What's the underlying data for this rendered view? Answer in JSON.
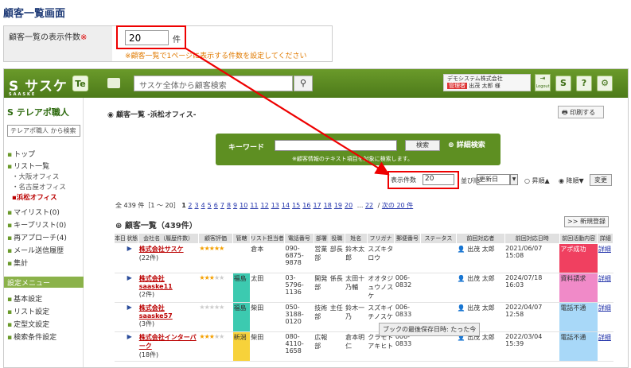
{
  "page": {
    "title": "顧客一覧画面"
  },
  "setting": {
    "label": "顧客一覧の表示件数",
    "required_mark": "※",
    "value": "20",
    "unit": "件",
    "note": "※顧客一覧で1ページに表示する件数を設定してください"
  },
  "topbar": {
    "logo": "サスケ",
    "logo_sub": "SAASKE",
    "te_label": "Te",
    "search_placeholder": "サスケ全体から顧客検索",
    "company": "デモシステム株式会社",
    "user_tag": "管理者",
    "user_name": "出茂 太郎 様",
    "logout_label": "Logout",
    "s_btn": "S",
    "help_btn": "?"
  },
  "sidebar": {
    "title": "テレアポ職人",
    "search_placeholder": "テレアポ職人 から検索",
    "items": [
      "トップ",
      "リスト一覧",
      "大阪オフィス",
      "名古屋オフィス",
      "浜松オフィス",
      "マイリスト(0)",
      "キープリスト(0)",
      "再アプローチ(4)",
      "メール送信履歴",
      "集計"
    ],
    "settings_title": "設定メニュー",
    "settings_items": [
      "基本設定",
      "リスト設定",
      "定型文設定",
      "検索条件設定"
    ]
  },
  "main": {
    "breadcrumb": "顧客一覧 -浜松オフィス-",
    "print_label": "印刷する",
    "keyword_label": "キーワード",
    "search_button": "検索",
    "detail_search": "詳細検索",
    "keyword_note": "※顧客情報のテキスト項目を対象に検索します。",
    "count_label": "表示件数",
    "count_value": "20",
    "sort_label": "並び順",
    "sort_value": "更新日",
    "asc_label": "昇順▲",
    "desc_label": "降順▼",
    "change_button": "変更",
    "pager_prefix": "全 439 件［1 ～ 20］",
    "pager_current": "1",
    "pager_links": [
      "2",
      "3",
      "4",
      "5",
      "6",
      "7",
      "8",
      "9",
      "10",
      "11",
      "12",
      "13",
      "14",
      "15",
      "16",
      "17",
      "18",
      "19",
      "20"
    ],
    "pager_dots": "...",
    "pager_last": "22",
    "pager_next": "次の 20 件",
    "list_title": "顧客一覧（439件）",
    "new_button": ">> 新規登録",
    "tooltip": "ブックの最後保存日時: たった今"
  },
  "table": {
    "headers": [
      "本日",
      "状態",
      "会社名（履歴件数）",
      "顧客評価",
      "管轄",
      "リスト担当者",
      "電話番号",
      "部署",
      "役職",
      "姓名",
      "フリガナ",
      "郵便番号",
      "ステータス",
      "前回対応者",
      "前回対応日時",
      "前回活動内容",
      "詳細"
    ],
    "rows": [
      {
        "name": "株式会社サスケ",
        "count": "(22件)",
        "stars": 5,
        "pref": "",
        "rep": "倉本",
        "tel": "090-6875-9878",
        "dept": "営業部",
        "pos": "部長",
        "person": "鈴木太郎",
        "kana": "スズキタロウ",
        "zip": "",
        "resp": "出茂 太郎",
        "date": "2021/06/07 15:08",
        "activity": "アポ成功",
        "cls": "status-red",
        "detail": "詳細"
      },
      {
        "name": "株式会社saaske11",
        "count": "(2件)",
        "stars": 3,
        "pref": "福島",
        "rep": "太田",
        "tel": "03-5796-1136",
        "dept": "開発部",
        "pos": "係長",
        "person": "太田十乃輔",
        "kana": "オオタジュウノスケ",
        "zip": "006-0832",
        "resp": "出茂 太郎",
        "date": "2024/07/18 16:03",
        "activity": "資料請求",
        "cls": "status-pink",
        "detail": "詳細"
      },
      {
        "name": "株式会社saaske57",
        "count": "(3件)",
        "stars": 0,
        "pref": "福島",
        "rep": "柴田",
        "tel": "050-3188-0120",
        "dept": "技術部",
        "pos": "主任",
        "person": "鈴木一乃",
        "kana": "スズキイチノスケ",
        "zip": "006-0833",
        "resp": "出茂 太郎",
        "date": "2022/04/07 12:58",
        "activity": "電話不通",
        "cls": "status-blue",
        "detail": "詳細"
      },
      {
        "name": "株式会社インターパーク",
        "count": "(18件)",
        "stars": 3,
        "pref": "新潟",
        "rep": "柴田",
        "tel": "080-4110-1658",
        "dept": "広報部",
        "pos": "",
        "person": "倉本明仁",
        "kana": "クラモトアキヒト",
        "zip": "006-0833",
        "resp": "出茂 太郎",
        "date": "2022/03/04 15:39",
        "activity": "電話不通",
        "cls": "status-blue",
        "detail": "詳細"
      }
    ]
  },
  "colors": {
    "brand": "#5e8f22",
    "alert": "#e00000",
    "link": "#2233aa"
  }
}
